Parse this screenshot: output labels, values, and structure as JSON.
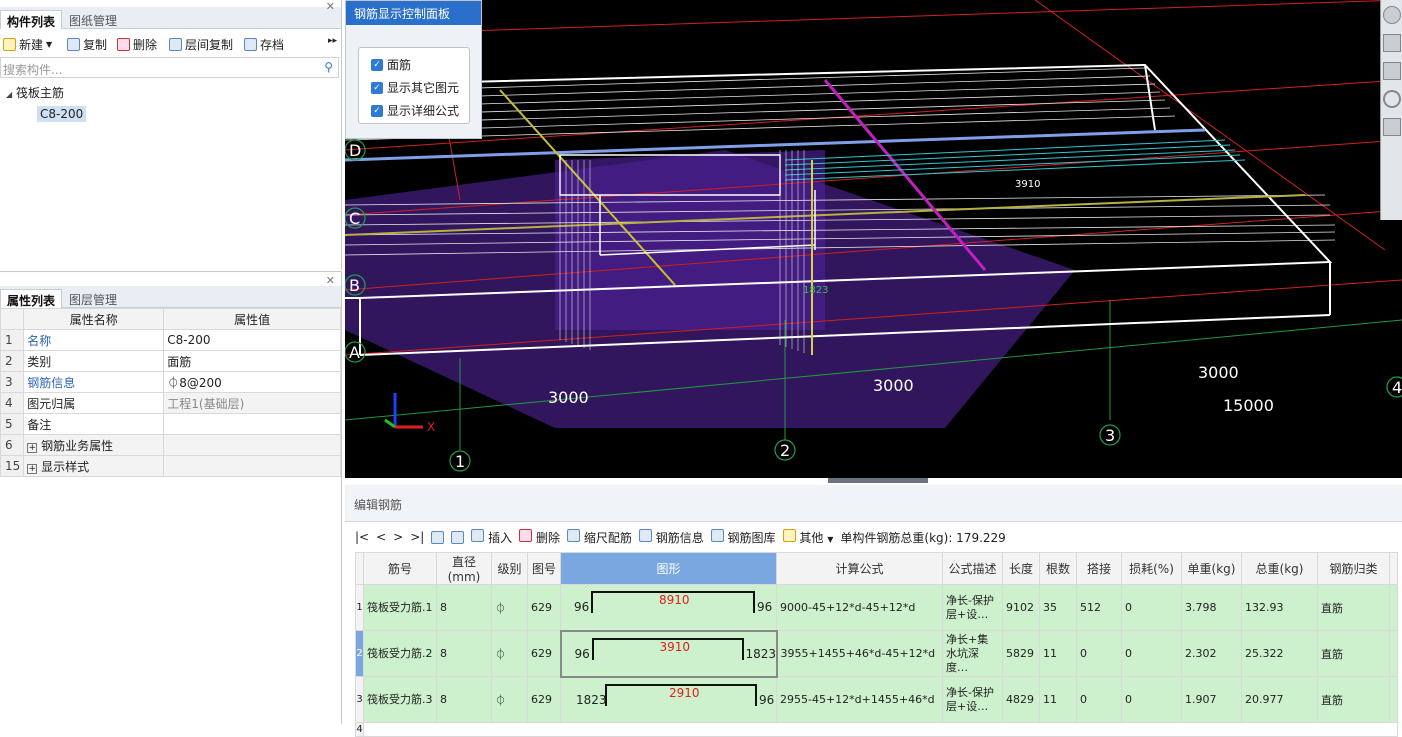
{
  "left_top_panel": {
    "tabs": [
      "构件列表",
      "图纸管理"
    ],
    "toolbar": {
      "new": "新建",
      "copy": "复制",
      "delete": "删除",
      "floor_copy": "层间复制",
      "archive": "存档"
    },
    "search_placeholder": "搜索构件...",
    "tree_root": "筏板主筋",
    "tree_child": "C8-200"
  },
  "props_panel": {
    "tabs": [
      "属性列表",
      "图层管理"
    ],
    "header": {
      "name": "属性名称",
      "value": "属性值"
    },
    "rows": [
      {
        "n": "1",
        "name": "名称",
        "value": "C8-200"
      },
      {
        "n": "2",
        "name": "类别",
        "value": "面筋"
      },
      {
        "n": "3",
        "name": "钢筋信息",
        "value": "⏀8@200"
      },
      {
        "n": "4",
        "name": "图元归属",
        "value": "工程1(基础层)"
      },
      {
        "n": "5",
        "name": "备注",
        "value": ""
      },
      {
        "n": "6",
        "name": "钢筋业务属性",
        "value": ""
      },
      {
        "n": "15",
        "name": "显示样式",
        "value": ""
      }
    ]
  },
  "control_panel": {
    "title": "钢筋显示控制面板",
    "options": [
      "面筋",
      "显示其它图元",
      "显示详细公式"
    ]
  },
  "viewport": {
    "axis_rows": [
      "D",
      "C",
      "B",
      "A"
    ],
    "axis_cols": [
      "1",
      "2",
      "3",
      "4"
    ],
    "dims": [
      "3000",
      "3000",
      "3000",
      "15000"
    ],
    "labels": [
      "3910",
      "1823"
    ]
  },
  "editor": {
    "title": "编辑钢筋",
    "toolbar": {
      "insert": "插入",
      "delete": "删除",
      "scale": "缩尺配筋",
      "info": "钢筋信息",
      "lib": "钢筋图库",
      "other": "其他",
      "total": "单构件钢筋总重(kg): 179.229"
    },
    "columns": [
      "筋号",
      "直径(mm)",
      "级别",
      "图号",
      "图形",
      "计算公式",
      "公式描述",
      "长度",
      "根数",
      "搭接",
      "损耗(%)",
      "单重(kg)",
      "总重(kg)",
      "钢筋归类"
    ],
    "rows": [
      {
        "n": "1",
        "name": "筏板受力筋.1",
        "d": "8",
        "grade": "⏀",
        "fig": "629",
        "left": "96",
        "mid": "8910",
        "right": "96",
        "formula": "9000-45+12*d-45+12*d",
        "desc": "净长-保护层+设…",
        "len": "9102",
        "count": "35",
        "lap": "512",
        "loss": "0",
        "unit": "3.798",
        "total": "132.93",
        "cat": "直筋"
      },
      {
        "n": "2",
        "name": "筏板受力筋.2",
        "d": "8",
        "grade": "⏀",
        "fig": "629",
        "left": "96",
        "mid": "3910",
        "right": "1823",
        "formula": "3955+1455+46*d-45+12*d",
        "desc": "净长+集水坑深度…",
        "len": "5829",
        "count": "11",
        "lap": "0",
        "loss": "0",
        "unit": "2.302",
        "total": "25.322",
        "cat": "直筋"
      },
      {
        "n": "3",
        "name": "筏板受力筋.3",
        "d": "8",
        "grade": "⏀",
        "fig": "629",
        "left": "1823",
        "mid": "2910",
        "right": "96",
        "formula": "2955-45+12*d+1455+46*d",
        "desc": "净长-保护层+设…",
        "len": "4829",
        "count": "11",
        "lap": "0",
        "loss": "0",
        "unit": "1.907",
        "total": "20.977",
        "cat": "直筋"
      }
    ],
    "row4": "4"
  }
}
